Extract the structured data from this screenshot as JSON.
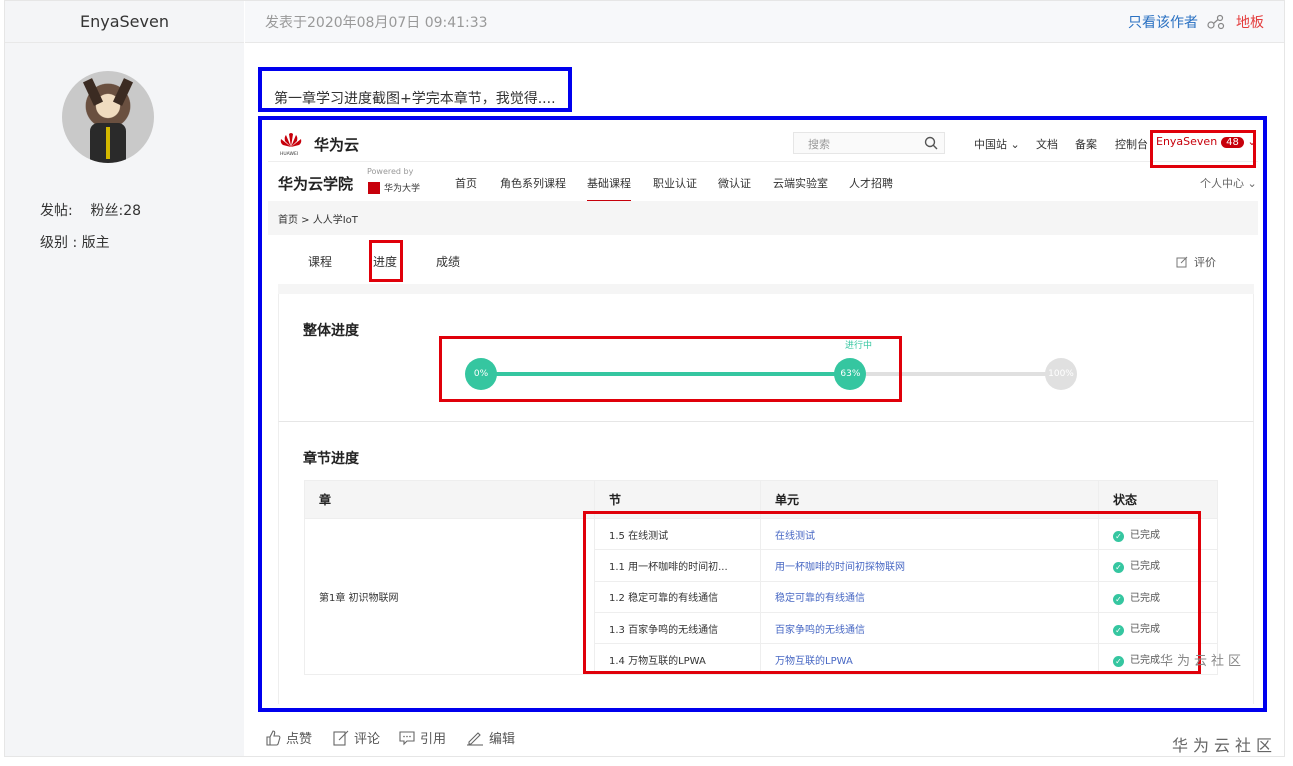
{
  "author": {
    "name": "EnyaSeven",
    "posts_label": "发帖:",
    "fans_label": "粉丝:28",
    "level_label": "级别 : 版主"
  },
  "post": {
    "date": "发表于2020年08月07日 09:41:33",
    "author_only": "只看该作者",
    "floor": "地板",
    "text": "第一章学习进度截图+学完本章节，我觉得...."
  },
  "screenshot": {
    "brand": "华为云",
    "brand_sub": "HUAWEI",
    "search_placeholder": "搜索",
    "top_links": [
      "中国站 ⌄",
      "文档",
      "备案",
      "控制台"
    ],
    "user": "EnyaSeven",
    "user_badge": "48",
    "academy_title": "华为云学院",
    "powered_by": "Powered by",
    "huawei_university": "华为大学",
    "nav": [
      "首页",
      "角色系列课程",
      "基础课程",
      "职业认证",
      "微认证",
      "云端实验室",
      "人才招聘"
    ],
    "nav_active_index": 2,
    "personal_center": "个人中心 ⌄",
    "breadcrumb": "首页 > 人人学IoT",
    "tabs": [
      "课程",
      "进度",
      "成绩"
    ],
    "active_tab_index": 1,
    "evaluate": "评价",
    "overall_title": "整体进度",
    "progress": {
      "value_percent": 63,
      "start_label": "0%",
      "current_label": "63%",
      "end_label": "100%",
      "status": "进行中"
    },
    "chapter_title": "章节进度",
    "table": {
      "headers": [
        "章",
        "节",
        "单元",
        "状态"
      ],
      "chapter": "第1章 初识物联网",
      "rows": [
        {
          "section": "1.5 在线测试",
          "unit": "在线测试",
          "status": "已完成"
        },
        {
          "section": "1.1 用一杯咖啡的时间初...",
          "unit": "用一杯咖啡的时间初探物联网",
          "status": "已完成"
        },
        {
          "section": "1.2 稳定可靠的有线通信",
          "unit": "稳定可靠的有线通信",
          "status": "已完成"
        },
        {
          "section": "1.3 百家争鸣的无线通信",
          "unit": "百家争鸣的无线通信",
          "status": "已完成"
        },
        {
          "section": "1.4 万物互联的LPWA",
          "unit": "万物互联的LPWA",
          "status": "已完成"
        }
      ]
    },
    "watermark": "华为云社区"
  },
  "actions": {
    "like": "点赞",
    "comment": "评论",
    "quote": "引用",
    "edit": "编辑"
  },
  "watermark": "华为云社区",
  "colors": {
    "annotation_blue": "#0000ee",
    "annotation_red": "#e0000a",
    "progress_green": "#35c6a0",
    "huawei_red": "#c7000b",
    "link_blue": "#2a71c2"
  }
}
